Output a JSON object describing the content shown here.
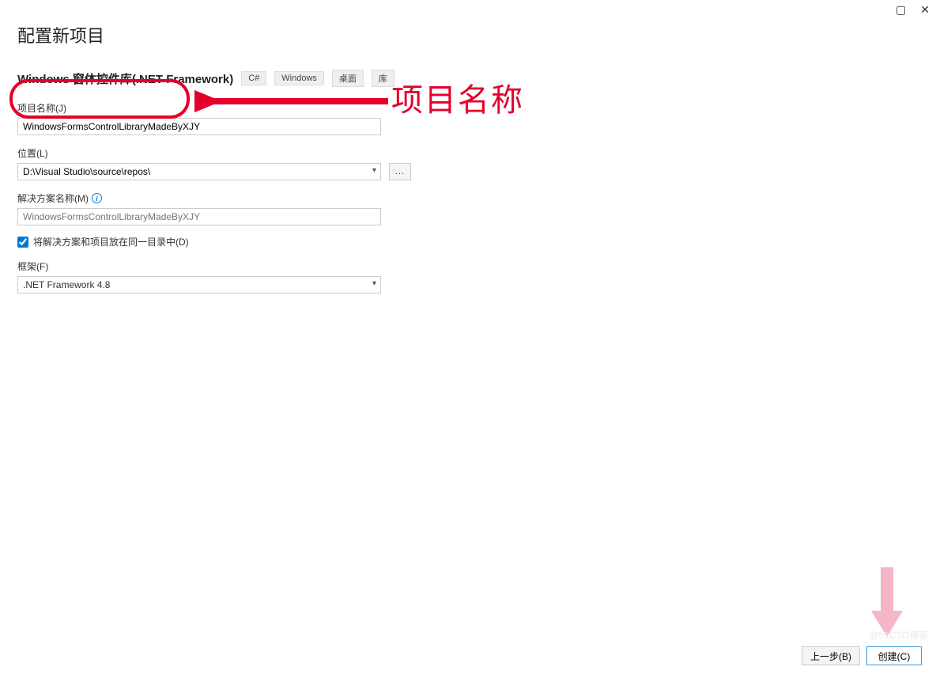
{
  "window": {
    "maximize_glyph": "▢",
    "close_glyph": "✕"
  },
  "page_title": "配置新项目",
  "subtitle": "Windows 窗体控件库(.NET Framework)",
  "tags": [
    "C#",
    "Windows",
    "桌面",
    "库"
  ],
  "project_name": {
    "label": "项目名称(J)",
    "value": "WindowsFormsControlLibraryMadeByXJY"
  },
  "location": {
    "label": "位置(L)",
    "value": "D:\\Visual Studio\\source\\repos\\",
    "browse": "..."
  },
  "solution_name": {
    "label": "解决方案名称(M)",
    "placeholder": "WindowsFormsControlLibraryMadeByXJY"
  },
  "same_dir": {
    "label": "将解决方案和项目放在同一目录中(D)",
    "checked": true
  },
  "framework": {
    "label": "框架(F)",
    "value": ".NET Framework 4.8"
  },
  "footer": {
    "back": "上一步(B)",
    "create": "创建(C)"
  },
  "annotation": {
    "text": "项目名称"
  },
  "watermark": "@51CTO博客"
}
